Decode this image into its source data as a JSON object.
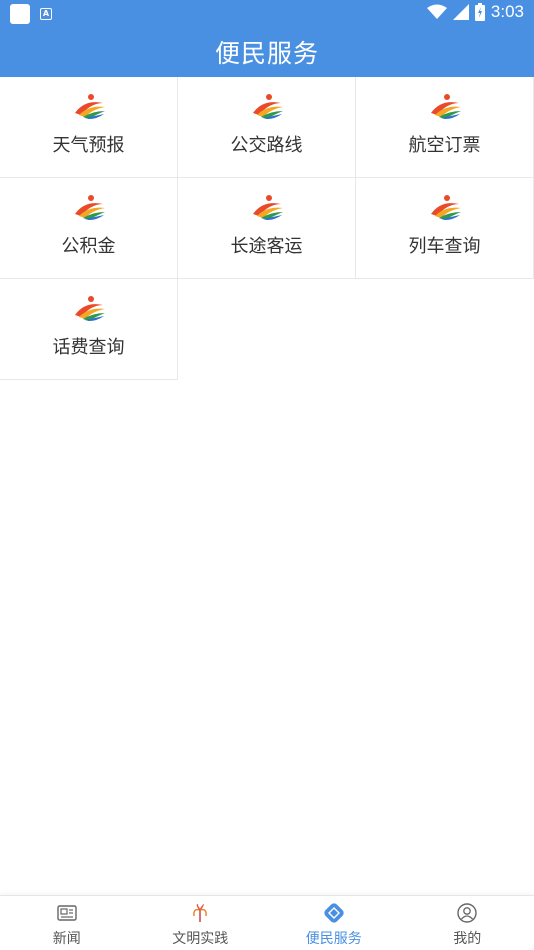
{
  "status_bar": {
    "time": "3:03",
    "left_icons": [
      "notification-square-icon",
      "a-badge-icon"
    ],
    "right_icons": [
      "wifi-icon",
      "signal-icon",
      "battery-icon"
    ]
  },
  "header": {
    "title": "便民服务",
    "background_color": "#4a90e2"
  },
  "services": [
    {
      "label": "天气预报",
      "icon": "service-logo-icon"
    },
    {
      "label": "公交路线",
      "icon": "service-logo-icon"
    },
    {
      "label": "航空订票",
      "icon": "service-logo-icon"
    },
    {
      "label": "公积金",
      "icon": "service-logo-icon"
    },
    {
      "label": "长途客运",
      "icon": "service-logo-icon"
    },
    {
      "label": "列车查询",
      "icon": "service-logo-icon"
    },
    {
      "label": "话费查询",
      "icon": "service-logo-icon"
    }
  ],
  "bottom_nav": {
    "items": [
      {
        "label": "新闻",
        "icon": "news-icon",
        "active": false
      },
      {
        "label": "文明实践",
        "icon": "civilization-icon",
        "active": false
      },
      {
        "label": "便民服务",
        "icon": "service-icon",
        "active": true
      },
      {
        "label": "我的",
        "icon": "profile-icon",
        "active": false
      }
    ],
    "active_color": "#4a90e2",
    "inactive_color": "#555555"
  }
}
